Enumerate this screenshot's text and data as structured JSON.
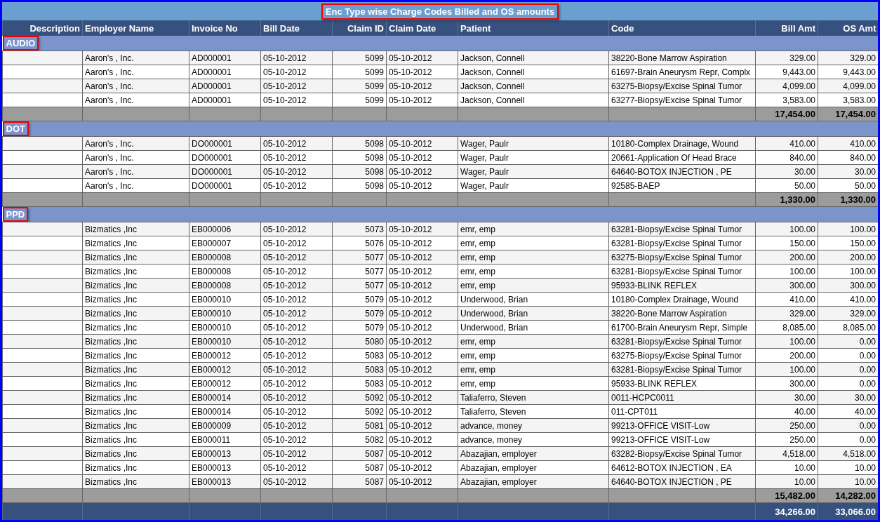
{
  "title": "Enc Type wise Charge Codes Billed and OS amounts",
  "columns": [
    "Description",
    "Employer Name",
    "Invoice No",
    "Bill Date",
    "Claim ID",
    "Claim Date",
    "Patient",
    "Code",
    "Bill Amt",
    "OS Amt"
  ],
  "groups": [
    {
      "name": "AUDIO",
      "rows": [
        [
          "",
          "Aaron's , Inc.",
          "AD000001",
          "05-10-2012",
          "5099",
          "05-10-2012",
          "Jackson, Connell",
          "38220-Bone Marrow Aspiration",
          "329.00",
          "329.00"
        ],
        [
          "",
          "Aaron's , Inc.",
          "AD000001",
          "05-10-2012",
          "5099",
          "05-10-2012",
          "Jackson, Connell",
          "61697-Brain Aneurysm Repr, Complx",
          "9,443.00",
          "9,443.00"
        ],
        [
          "",
          "Aaron's , Inc.",
          "AD000001",
          "05-10-2012",
          "5099",
          "05-10-2012",
          "Jackson, Connell",
          "63275-Biopsy/Excise Spinal Tumor",
          "4,099.00",
          "4,099.00"
        ],
        [
          "",
          "Aaron's , Inc.",
          "AD000001",
          "05-10-2012",
          "5099",
          "05-10-2012",
          "Jackson, Connell",
          "63277-Biopsy/Excise Spinal Tumor",
          "3,583.00",
          "3,583.00"
        ]
      ],
      "bill_total": "17,454.00",
      "os_total": "17,454.00"
    },
    {
      "name": "DOT",
      "rows": [
        [
          "",
          "Aaron's , Inc.",
          "DO000001",
          "05-10-2012",
          "5098",
          "05-10-2012",
          "Wager, Paulr",
          "10180-Complex Drainage, Wound",
          "410.00",
          "410.00"
        ],
        [
          "",
          "Aaron's , Inc.",
          "DO000001",
          "05-10-2012",
          "5098",
          "05-10-2012",
          "Wager, Paulr",
          "20661-Application Of Head Brace",
          "840.00",
          "840.00"
        ],
        [
          "",
          "Aaron's , Inc.",
          "DO000001",
          "05-10-2012",
          "5098",
          "05-10-2012",
          "Wager, Paulr",
          "64640-BOTOX INJECTION , PE",
          "30.00",
          "30.00"
        ],
        [
          "",
          "Aaron's , Inc.",
          "DO000001",
          "05-10-2012",
          "5098",
          "05-10-2012",
          "Wager, Paulr",
          "92585-BAEP",
          "50.00",
          "50.00"
        ]
      ],
      "bill_total": "1,330.00",
      "os_total": "1,330.00"
    },
    {
      "name": "PPD",
      "rows": [
        [
          "",
          "Bizmatics ,Inc",
          "EB000006",
          "05-10-2012",
          "5073",
          "05-10-2012",
          "emr, emp",
          "63281-Biopsy/Excise Spinal Tumor",
          "100.00",
          "100.00"
        ],
        [
          "",
          "Bizmatics ,Inc",
          "EB000007",
          "05-10-2012",
          "5076",
          "05-10-2012",
          "emr, emp",
          "63281-Biopsy/Excise Spinal Tumor",
          "150.00",
          "150.00"
        ],
        [
          "",
          "Bizmatics ,Inc",
          "EB000008",
          "05-10-2012",
          "5077",
          "05-10-2012",
          "emr, emp",
          "63275-Biopsy/Excise Spinal Tumor",
          "200.00",
          "200.00"
        ],
        [
          "",
          "Bizmatics ,Inc",
          "EB000008",
          "05-10-2012",
          "5077",
          "05-10-2012",
          "emr, emp",
          "63281-Biopsy/Excise Spinal Tumor",
          "100.00",
          "100.00"
        ],
        [
          "",
          "Bizmatics ,Inc",
          "EB000008",
          "05-10-2012",
          "5077",
          "05-10-2012",
          "emr, emp",
          "95933-BLINK REFLEX",
          "300.00",
          "300.00"
        ],
        [
          "",
          "Bizmatics ,Inc",
          "EB000010",
          "05-10-2012",
          "5079",
          "05-10-2012",
          "Underwood, Brian",
          "10180-Complex Drainage, Wound",
          "410.00",
          "410.00"
        ],
        [
          "",
          "Bizmatics ,Inc",
          "EB000010",
          "05-10-2012",
          "5079",
          "05-10-2012",
          "Underwood, Brian",
          "38220-Bone Marrow Aspiration",
          "329.00",
          "329.00"
        ],
        [
          "",
          "Bizmatics ,Inc",
          "EB000010",
          "05-10-2012",
          "5079",
          "05-10-2012",
          "Underwood, Brian",
          "61700-Brain Aneurysm Repr, Simple",
          "8,085.00",
          "8,085.00"
        ],
        [
          "",
          "Bizmatics ,Inc",
          "EB000010",
          "05-10-2012",
          "5080",
          "05-10-2012",
          "emr, emp",
          "63281-Biopsy/Excise Spinal Tumor",
          "100.00",
          "0.00"
        ],
        [
          "",
          "Bizmatics ,Inc",
          "EB000012",
          "05-10-2012",
          "5083",
          "05-10-2012",
          "emr, emp",
          "63275-Biopsy/Excise Spinal Tumor",
          "200.00",
          "0.00"
        ],
        [
          "",
          "Bizmatics ,Inc",
          "EB000012",
          "05-10-2012",
          "5083",
          "05-10-2012",
          "emr, emp",
          "63281-Biopsy/Excise Spinal Tumor",
          "100.00",
          "0.00"
        ],
        [
          "",
          "Bizmatics ,Inc",
          "EB000012",
          "05-10-2012",
          "5083",
          "05-10-2012",
          "emr, emp",
          "95933-BLINK REFLEX",
          "300.00",
          "0.00"
        ],
        [
          "",
          "Bizmatics ,Inc",
          "EB000014",
          "05-10-2012",
          "5092",
          "05-10-2012",
          "Taliaferro, Steven",
          "0011-HCPC0011",
          "30.00",
          "30.00"
        ],
        [
          "",
          "Bizmatics ,Inc",
          "EB000014",
          "05-10-2012",
          "5092",
          "05-10-2012",
          "Taliaferro, Steven",
          "011-CPT011",
          "40.00",
          "40.00"
        ],
        [
          "",
          "Bizmatics ,Inc",
          "EB000009",
          "05-10-2012",
          "5081",
          "05-10-2012",
          "advance, money",
          "99213-OFFICE VISIT-Low",
          "250.00",
          "0.00"
        ],
        [
          "",
          "Bizmatics ,Inc",
          "EB000011",
          "05-10-2012",
          "5082",
          "05-10-2012",
          "advance, money",
          "99213-OFFICE VISIT-Low",
          "250.00",
          "0.00"
        ],
        [
          "",
          "Bizmatics ,Inc",
          "EB000013",
          "05-10-2012",
          "5087",
          "05-10-2012",
          "Abazajian, employer",
          "63282-Biopsy/Excise Spinal Tumor",
          "4,518.00",
          "4,518.00"
        ],
        [
          "",
          "Bizmatics ,Inc",
          "EB000013",
          "05-10-2012",
          "5087",
          "05-10-2012",
          "Abazajian, employer",
          "64612-BOTOX INJECTION , EA",
          "10.00",
          "10.00"
        ],
        [
          "",
          "Bizmatics ,Inc",
          "EB000013",
          "05-10-2012",
          "5087",
          "05-10-2012",
          "Abazajian, employer",
          "64640-BOTOX INJECTION , PE",
          "10.00",
          "10.00"
        ]
      ],
      "bill_total": "15,482.00",
      "os_total": "14,282.00"
    }
  ],
  "grand_total": {
    "bill": "34,266.00",
    "os": "33,066.00"
  }
}
